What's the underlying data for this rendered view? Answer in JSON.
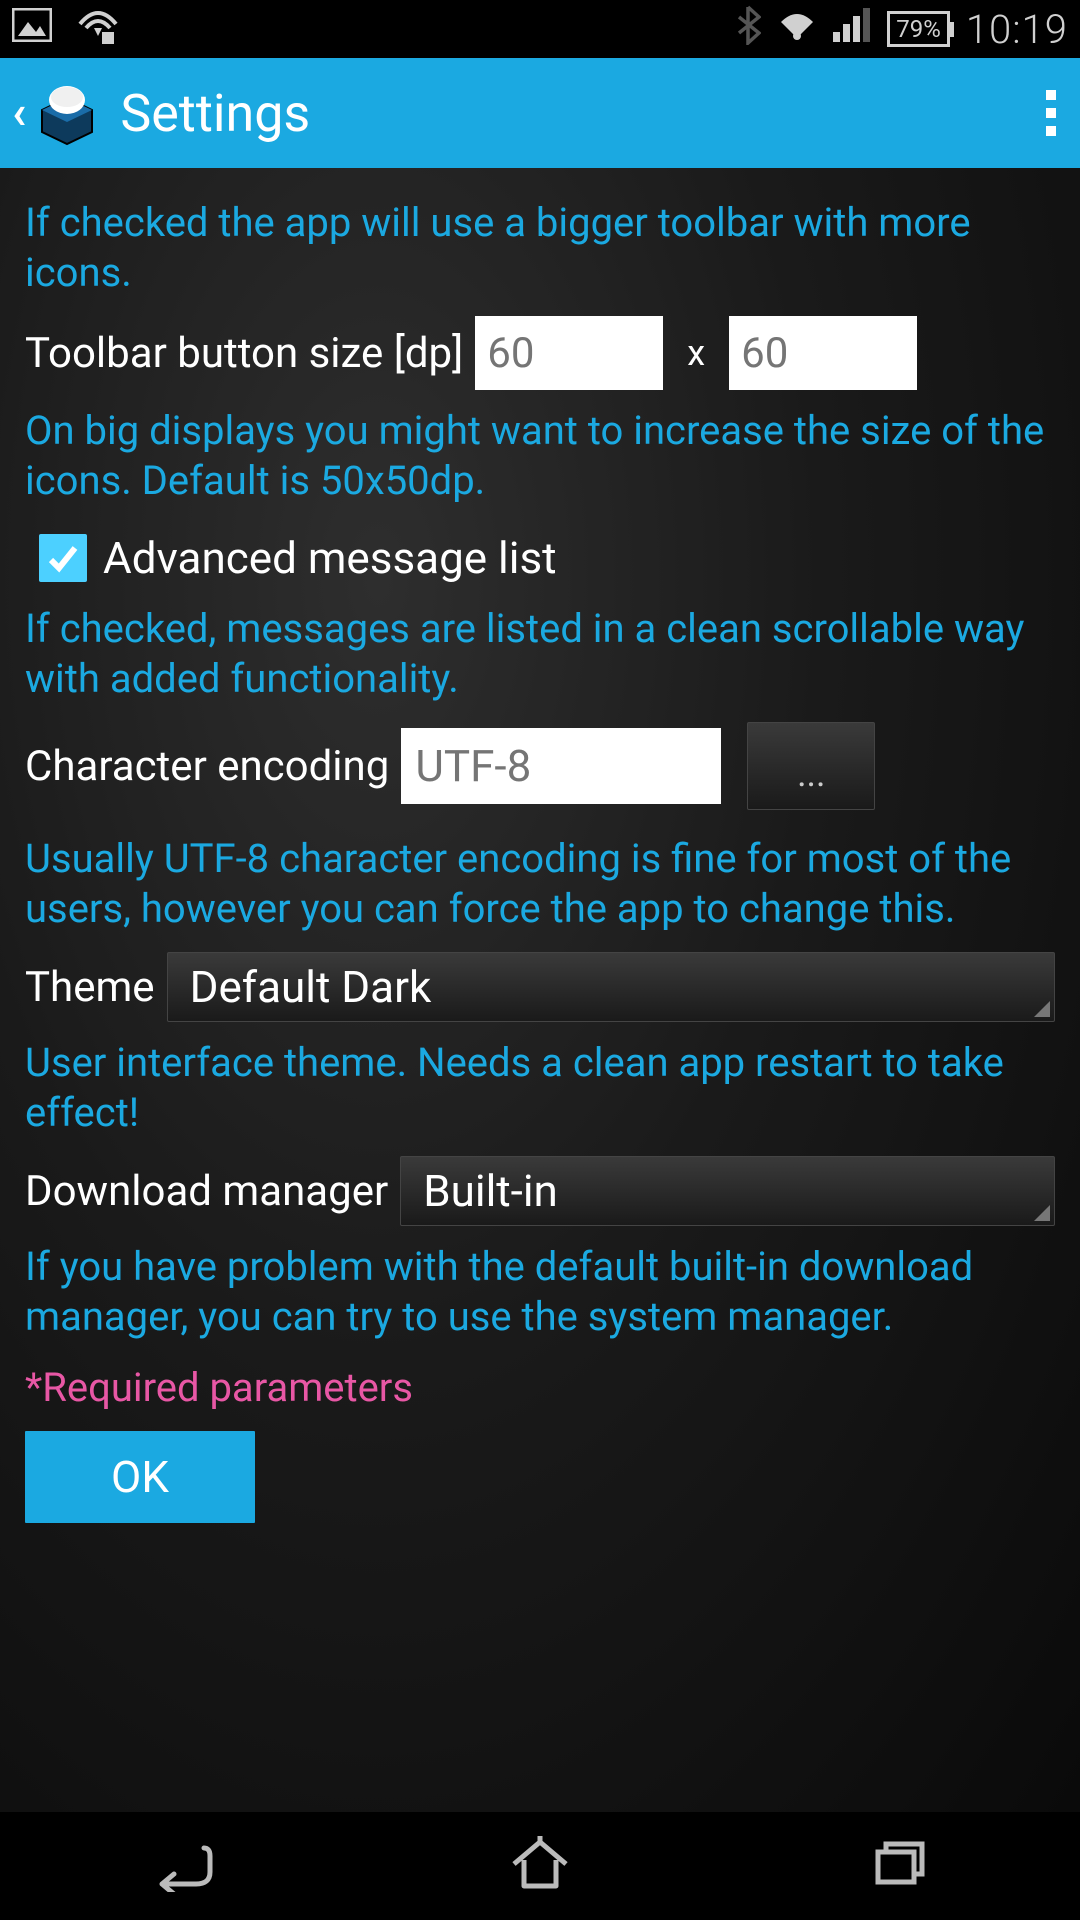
{
  "status": {
    "battery_pct": "79%",
    "clock": "10:19"
  },
  "header": {
    "title": "Settings"
  },
  "settings": {
    "bigger_toolbar_info": "If checked the app will use a bigger toolbar with more icons.",
    "toolbar_label": "Toolbar button size [dp]",
    "toolbar_w": "60",
    "toolbar_h": "60",
    "toolbar_separator": "x",
    "size_hint": "On big displays you might want to increase the size of the icons. Default is 50x50dp.",
    "advanced_list_checked": true,
    "advanced_list_label": "Advanced message list",
    "advanced_list_hint": "If checked, messages are listed in a clean scrollable way with added functionality.",
    "encoding_label": "Character encoding",
    "encoding_value": "UTF-8",
    "encoding_browse": "...",
    "encoding_hint": "Usually UTF-8 character encoding is fine for most of the users, however you can force the app to change this.",
    "theme_label": "Theme",
    "theme_value": "Default Dark",
    "theme_hint": "User interface theme. Needs a clean app restart to take effect!",
    "dlmgr_label": "Download manager",
    "dlmgr_value": "Built-in",
    "dlmgr_hint": "If you have problem with the default built-in download manager, you can try to use the system manager.",
    "required": "*Required parameters",
    "ok": "OK"
  }
}
